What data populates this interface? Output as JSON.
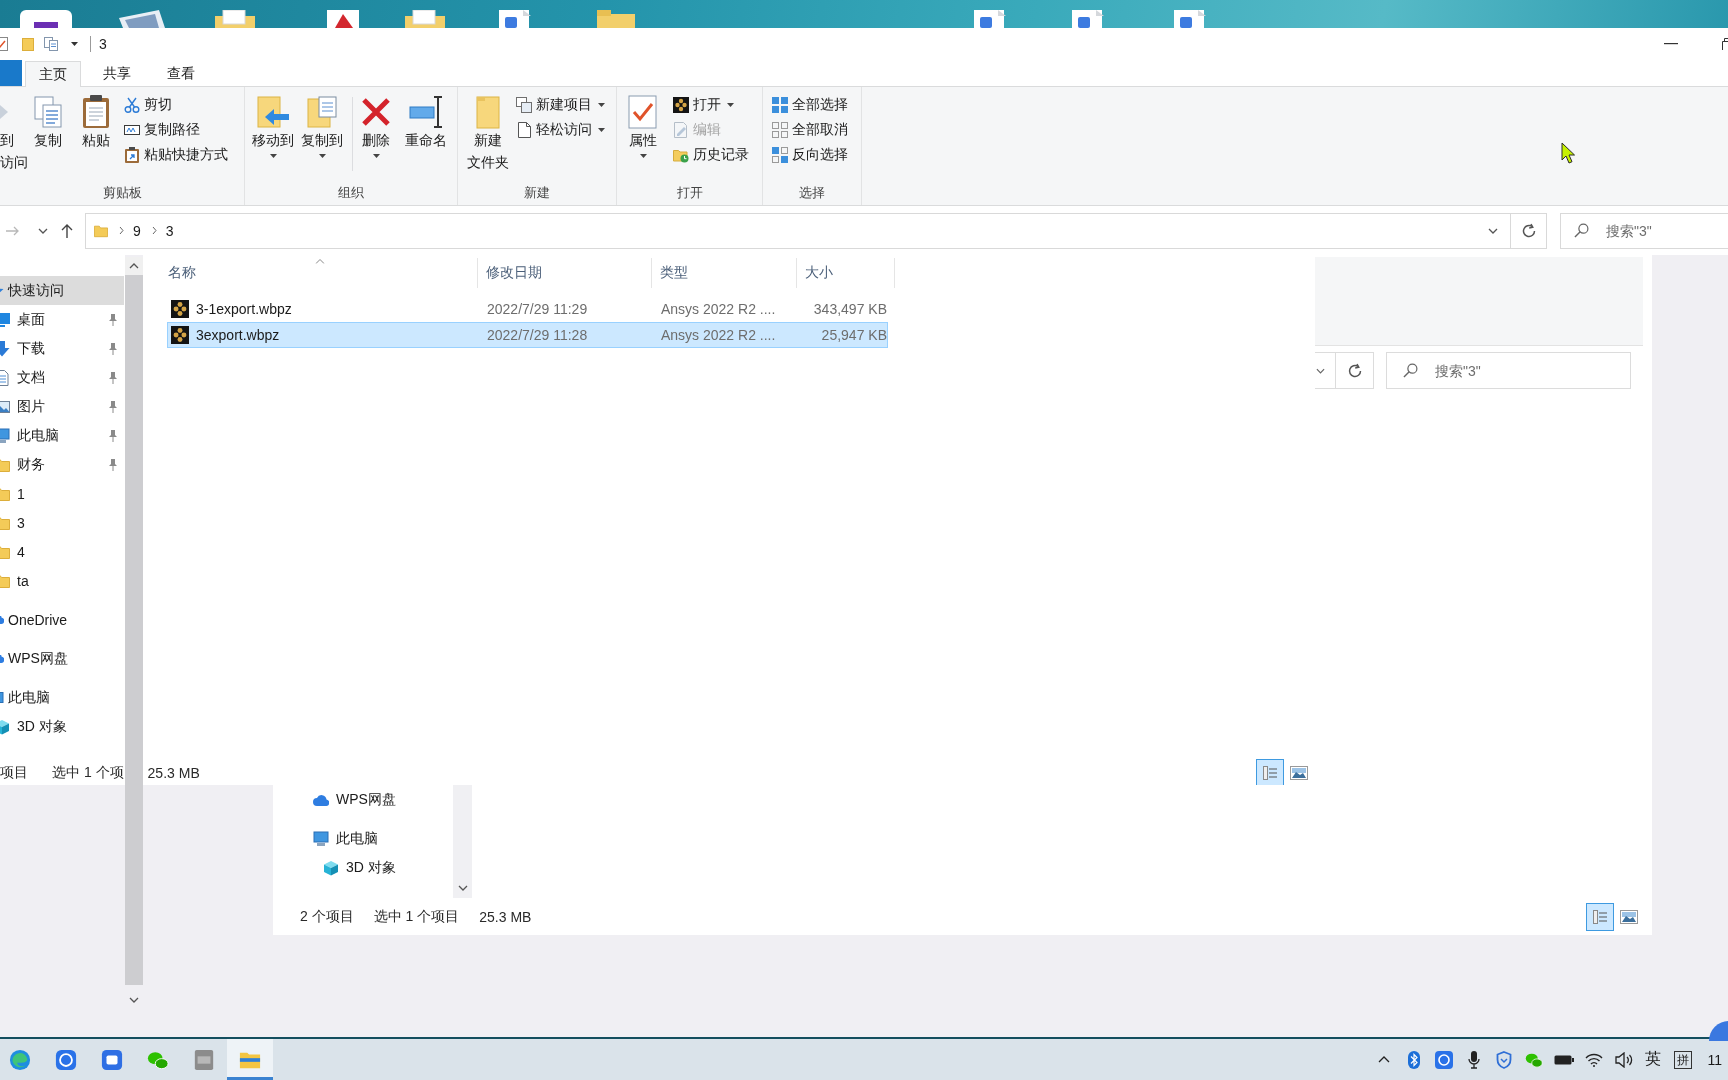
{
  "window": {
    "title": "3"
  },
  "tabs": [
    {
      "label": "主页",
      "selected": true
    },
    {
      "label": "共享",
      "selected": false
    },
    {
      "label": "查看",
      "selected": false
    }
  ],
  "ribbon": {
    "groups": [
      {
        "label": "剪贴板",
        "buttons": [
          {
            "kind": "large",
            "lines": [
              "到",
              "访问"
            ],
            "dropdown": false,
            "disabled": false
          },
          {
            "kind": "large",
            "lines": [
              "复制"
            ],
            "dropdown": false,
            "disabled": false
          },
          {
            "kind": "large",
            "lines": [
              "粘贴"
            ],
            "dropdown": false,
            "disabled": false
          },
          {
            "kind": "stack",
            "items": [
              {
                "label": "剪切",
                "dropdown": false,
                "disabled": false
              },
              {
                "label": "复制路径",
                "dropdown": false,
                "disabled": false
              },
              {
                "label": "粘贴快捷方式",
                "dropdown": false,
                "disabled": false
              }
            ]
          }
        ]
      },
      {
        "label": "组织",
        "buttons": [
          {
            "kind": "large",
            "lines": [
              "移动到"
            ],
            "dropdown": true,
            "disabled": false
          },
          {
            "kind": "large",
            "lines": [
              "复制到"
            ],
            "dropdown": true,
            "disabled": false
          },
          {
            "kind": "large",
            "lines": [
              "删除"
            ],
            "dropdown": true,
            "disabled": false
          },
          {
            "kind": "large",
            "lines": [
              "重命名"
            ],
            "dropdown": false,
            "disabled": false
          }
        ]
      },
      {
        "label": "新建",
        "buttons": [
          {
            "kind": "large",
            "lines": [
              "新建",
              "文件夹"
            ],
            "dropdown": false,
            "disabled": false
          },
          {
            "kind": "stack",
            "items": [
              {
                "label": "新建项目",
                "dropdown": true,
                "disabled": false
              },
              {
                "label": "轻松访问",
                "dropdown": true,
                "disabled": false
              }
            ]
          }
        ]
      },
      {
        "label": "打开",
        "buttons": [
          {
            "kind": "large",
            "lines": [
              "属性"
            ],
            "dropdown": true,
            "disabled": false
          },
          {
            "kind": "stack",
            "items": [
              {
                "label": "打开",
                "dropdown": true,
                "disabled": false
              },
              {
                "label": "编辑",
                "dropdown": false,
                "disabled": true
              },
              {
                "label": "历史记录",
                "dropdown": false,
                "disabled": false
              }
            ]
          }
        ]
      },
      {
        "label": "选择",
        "buttons": [
          {
            "kind": "stack",
            "items": [
              {
                "label": "全部选择",
                "dropdown": false,
                "disabled": false
              },
              {
                "label": "全部取消",
                "dropdown": false,
                "disabled": false
              },
              {
                "label": "反向选择",
                "dropdown": false,
                "disabled": false
              }
            ]
          }
        ]
      }
    ]
  },
  "address_bar": {
    "path": [
      "9",
      "3"
    ]
  },
  "search": {
    "placeholder": "搜索\"3\""
  },
  "navigation": [
    {
      "label": "快速访问",
      "selected": true,
      "children": [
        {
          "label": "桌面",
          "pinned": true,
          "selected": false
        },
        {
          "label": "下载",
          "pinned": true,
          "selected": false
        },
        {
          "label": "文档",
          "pinned": true,
          "selected": false
        },
        {
          "label": "图片",
          "pinned": true,
          "selected": false
        },
        {
          "label": "此电脑",
          "pinned": true,
          "selected": false
        },
        {
          "label": "财务",
          "pinned": true,
          "selected": false
        },
        {
          "label": "1",
          "pinned": false,
          "selected": false
        },
        {
          "label": "3",
          "pinned": false,
          "selected": false
        },
        {
          "label": "4",
          "pinned": false,
          "selected": false
        },
        {
          "label": "ta",
          "pinned": false,
          "selected": false
        }
      ]
    },
    {
      "label": "OneDrive",
      "selected": false
    },
    {
      "label": "WPS网盘",
      "selected": false
    },
    {
      "label": "此电脑",
      "selected": false,
      "children": [
        {
          "label": "3D 对象",
          "selected": false
        }
      ]
    }
  ],
  "files": {
    "columns": [
      {
        "label": "名称",
        "sorted": true
      },
      {
        "label": "修改日期",
        "sorted": false
      },
      {
        "label": "类型",
        "sorted": false
      },
      {
        "label": "大小",
        "sorted": false
      }
    ],
    "rows": [
      {
        "name": "3-1export.wbpz",
        "modified": "2022/7/29 11:29",
        "type": "Ansys 2022 R2 ....",
        "size": "343,497 KB",
        "selected": false
      },
      {
        "name": "3export.wbpz",
        "modified": "2022/7/29 11:28",
        "type": "Ansys 2022 R2 ....",
        "size": "25,947 KB",
        "selected": true
      }
    ]
  },
  "status_bar": {
    "items": [
      "项目",
      "选中 1 个项",
      "25.3 MB"
    ],
    "view_buttons": [
      {
        "selected": true
      },
      {
        "selected": false
      }
    ]
  },
  "background_window": {
    "search": {
      "placeholder": "搜索\"3\""
    },
    "navigation": [
      {
        "label": "WPS网盘",
        "selected": false
      },
      {
        "label": "此电脑",
        "selected": false,
        "children": [
          {
            "label": "3D 对象",
            "selected": false
          }
        ]
      }
    ],
    "status_bar": {
      "items": [
        "2 个项目",
        "选中 1 个项目",
        "25.3 MB"
      ],
      "view_buttons": [
        {
          "selected": true
        },
        {
          "selected": false
        }
      ]
    }
  },
  "taskbar": {
    "apps": [
      {
        "selected": false
      },
      {
        "selected": false
      },
      {
        "selected": false
      },
      {
        "selected": false
      },
      {
        "selected": false
      },
      {
        "selected": true
      }
    ],
    "tray": {
      "language": "英",
      "ime": "拼",
      "clock": "11"
    }
  }
}
